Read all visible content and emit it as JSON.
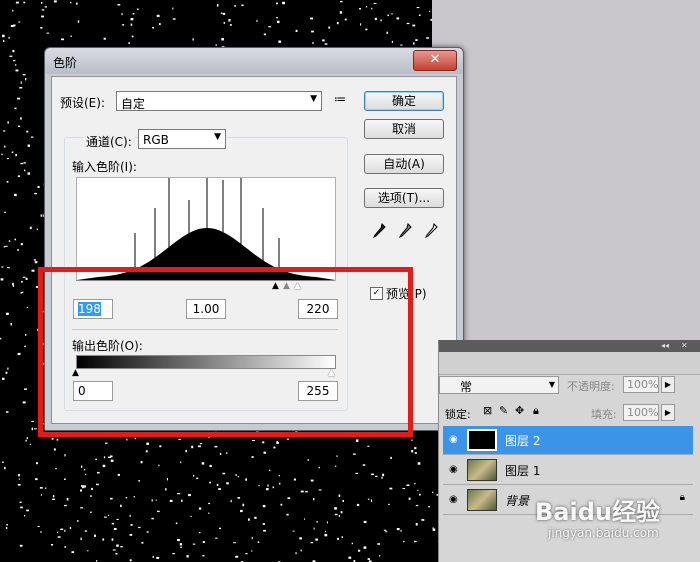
{
  "dialog": {
    "title": "色阶",
    "close_label": "✕",
    "preset_label": "预设(E):",
    "preset_value": "自定",
    "channel_label": "通道(C):",
    "channel_value": "RGB",
    "input_levels_label": "输入色阶(I):",
    "output_levels_label": "输出色阶(O):",
    "input_black": "198",
    "input_gamma": "1.00",
    "input_white": "220",
    "output_black": "0",
    "output_white": "255",
    "buttons": {
      "ok": "确定",
      "cancel": "取消",
      "auto": "自动(A)",
      "options": "选项(T)..."
    },
    "preview_label": "预览(P)",
    "preview_checked": true,
    "icons": [
      "preset-menu-icon",
      "black-eyedropper-icon",
      "gray-eyedropper-icon",
      "white-eyedropper-icon"
    ]
  },
  "layers_panel": {
    "blend_mode": "常",
    "opacity_label": "不透明度:",
    "opacity_value": "100%",
    "lock_label": "锁定:",
    "fill_label": "填充:",
    "fill_value": "100%",
    "layers": [
      {
        "name": "图层 2",
        "active": true,
        "thumb": "black"
      },
      {
        "name": "图层 1",
        "active": false,
        "thumb": "photo"
      },
      {
        "name": "背景",
        "active": false,
        "thumb": "photo",
        "locked": true
      }
    ]
  },
  "watermark": {
    "brand": "Baidu经验",
    "url": "jingyan.baidu.com"
  },
  "colors": {
    "highlight_red": "#e31b1b",
    "active_layer": "#3b94e7",
    "selection": "#3399ff"
  }
}
